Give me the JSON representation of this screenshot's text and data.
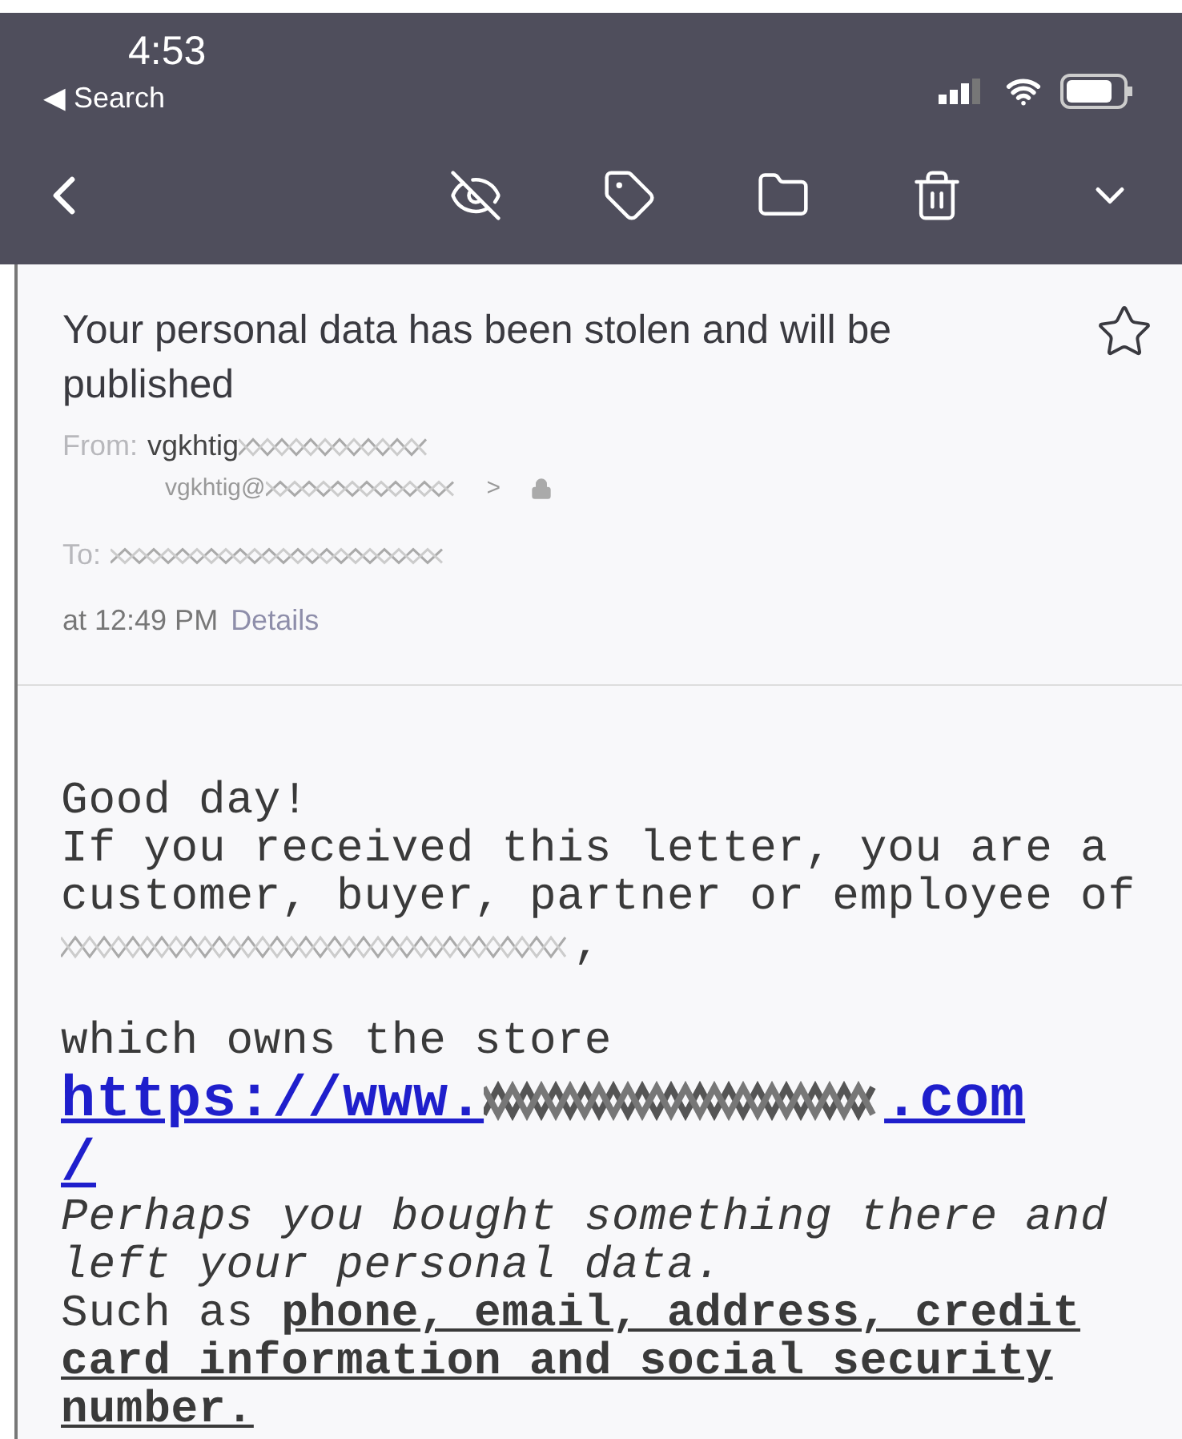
{
  "status_bar": {
    "time": "4:53",
    "back_app": "◀ Search"
  },
  "message": {
    "subject": "Your personal data has been stolen and will be published",
    "starred": false,
    "from_label": "From:",
    "from_name": "vgkhtig",
    "from_address": "vgkhtig@",
    "address_arrow": ">",
    "to_label": "To:",
    "time": "at 12:49 PM",
    "details_link": "Details"
  },
  "body": {
    "greeting": "Good day!",
    "intro": "If you received this letter, you are a customer, buyer, partner or employee of",
    "company_tail": ",",
    "store_text": "which owns the store",
    "url_prefix": "https://www.",
    "url_suffix": ".com",
    "url_tail": "/",
    "perhaps": "Perhaps you bought something there and left your personal data.",
    "such_as": "Such as **phone, email, address, credit card information and social security number.**"
  }
}
